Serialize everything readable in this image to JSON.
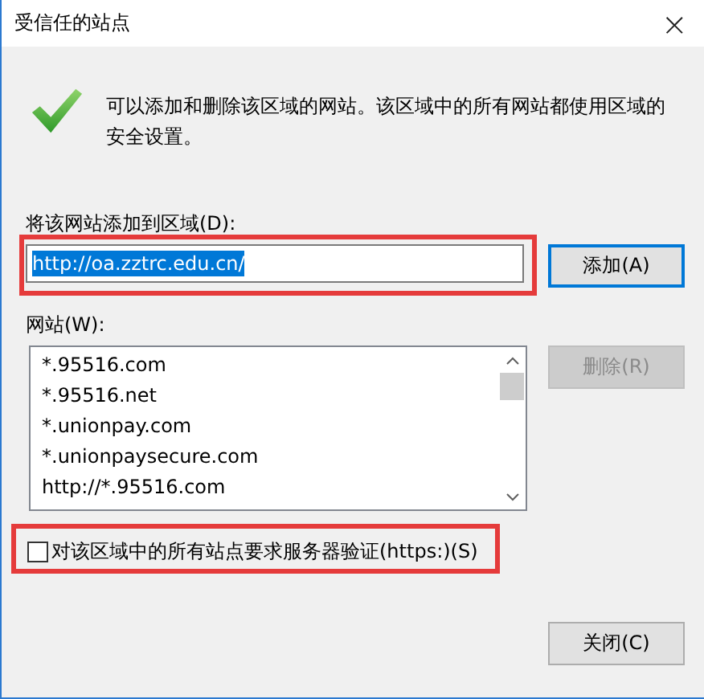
{
  "window": {
    "title": "受信任的站点",
    "close": "×"
  },
  "description": "可以添加和删除该区域的网站。该区域中的所有网站都使用区域的安全设置。",
  "add_field": {
    "label": "将该网站添加到区域(D):",
    "value": "http://oa.zztrc.edu.cn/",
    "text_selected": true,
    "highlighted": true
  },
  "add_button": {
    "label": "添加(A)",
    "focused": true,
    "disabled": false
  },
  "sites": {
    "label": "网站(W):",
    "items": [
      {
        "text": "*.95516.com"
      },
      {
        "text": "*.95516.net"
      },
      {
        "text": "*.unionpay.com"
      },
      {
        "text": "*.unionpaysecure.com"
      },
      {
        "text": "http://*.95516.com"
      }
    ]
  },
  "remove_button": {
    "label": "删除(R)",
    "focused": false,
    "disabled": true
  },
  "https_option": {
    "label": "对该区域中的所有站点要求服务器验证(https:)(S)",
    "checked": false,
    "highlighted": true
  },
  "close_button": {
    "label": "关闭(C)",
    "focused": false,
    "disabled": false
  }
}
